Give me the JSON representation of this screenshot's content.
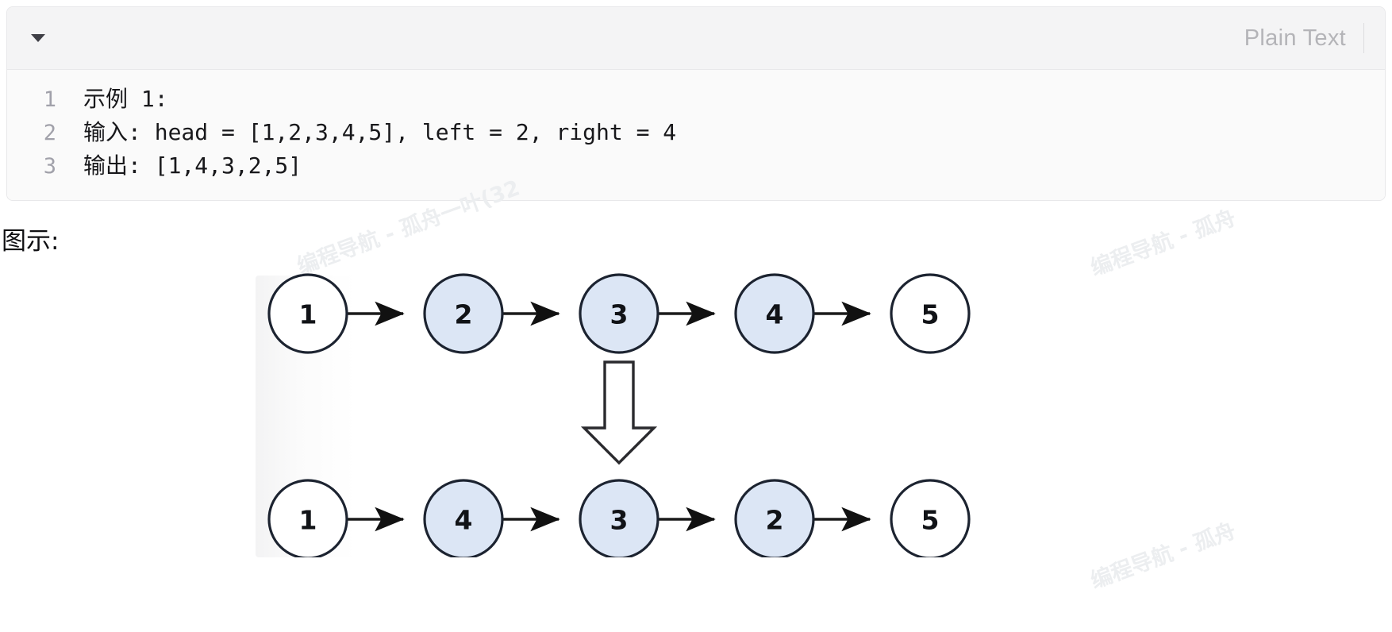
{
  "code_block": {
    "collapse_icon": "caret-down-icon",
    "language_label": "Plain Text",
    "lines": [
      {
        "number": "1",
        "text": "示例 1:"
      },
      {
        "number": "2",
        "text": "输入: head = [1,2,3,4,5], left = 2, right = 4"
      },
      {
        "number": "3",
        "text": "输出: [1,4,3,2,5]"
      }
    ]
  },
  "caption": "图示:",
  "diagram": {
    "top_row": [
      {
        "value": "1",
        "highlighted": false
      },
      {
        "value": "2",
        "highlighted": true
      },
      {
        "value": "3",
        "highlighted": true
      },
      {
        "value": "4",
        "highlighted": true
      },
      {
        "value": "5",
        "highlighted": false
      }
    ],
    "bottom_row": [
      {
        "value": "1",
        "highlighted": false
      },
      {
        "value": "4",
        "highlighted": true
      },
      {
        "value": "3",
        "highlighted": true
      },
      {
        "value": "2",
        "highlighted": true
      },
      {
        "value": "5",
        "highlighted": false
      }
    ],
    "transform_arrow": "block-arrow-down-icon",
    "colors": {
      "node_fill_default": "#ffffff",
      "node_fill_highlight": "#dce6f5",
      "node_stroke": "#1c2330",
      "link_stroke": "#1a1a1a"
    }
  },
  "watermarks": [
    {
      "text": "编程导航 - 孤舟一叶(32"
    },
    {
      "text": "编程导航 - 孤舟"
    },
    {
      "text": "编程导航 - 孤舟"
    }
  ]
}
